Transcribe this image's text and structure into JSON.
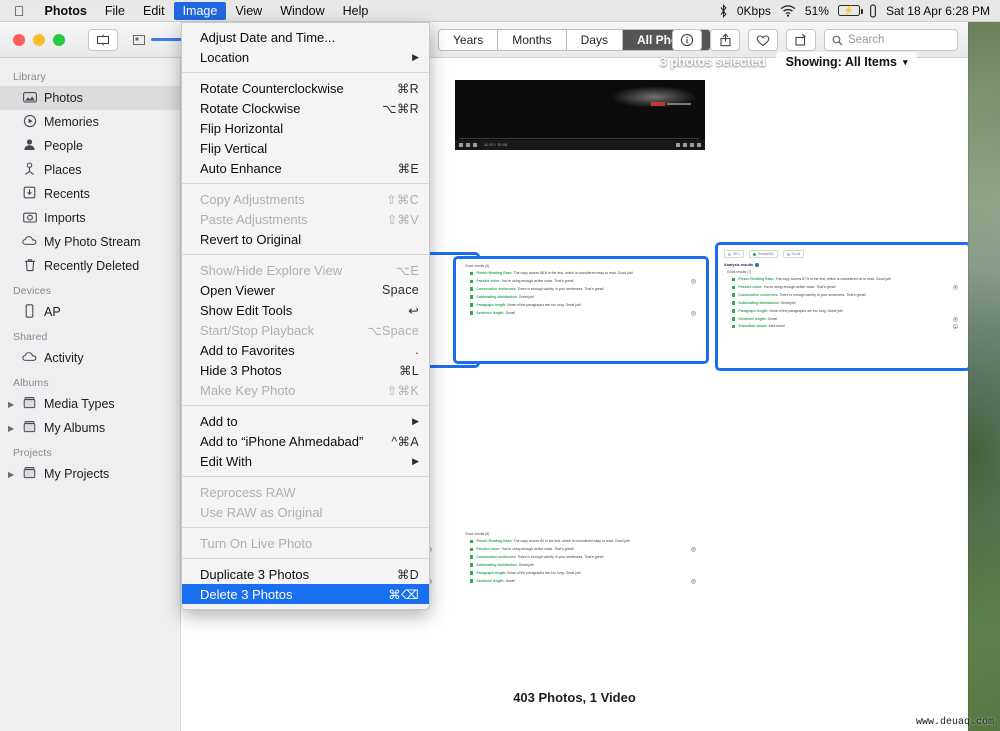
{
  "menubar": {
    "apple_icon": "apple-logo",
    "items": [
      {
        "label": "Photos",
        "bold": true,
        "active": false
      },
      {
        "label": "File",
        "bold": false,
        "active": false
      },
      {
        "label": "Edit",
        "bold": false,
        "active": false
      },
      {
        "label": "Image",
        "bold": false,
        "active": true
      },
      {
        "label": "View",
        "bold": false,
        "active": false
      },
      {
        "label": "Window",
        "bold": false,
        "active": false
      },
      {
        "label": "Help",
        "bold": false,
        "active": false
      }
    ],
    "status": {
      "bluetooth_icon": "bluetooth-icon",
      "network_speed": "0Kbps",
      "wifi_icon": "wifi-icon",
      "battery_percent": "51%",
      "battery_icon": "battery-charging-icon",
      "usb_icon": "usb-device-icon",
      "datetime": "Sat 18 Apr  6:28 PM"
    }
  },
  "toolbar": {
    "sidebar_toggle_icon": "sidebar-toggle-icon",
    "zoom_icon": "thumbnail-size-icon",
    "zoom_value": "100",
    "segments": [
      {
        "label": "Years",
        "on": false
      },
      {
        "label": "Months",
        "on": false
      },
      {
        "label": "Days",
        "on": false
      },
      {
        "label": "All Photos",
        "on": true
      }
    ],
    "info_icon": "info-icon",
    "share_icon": "share-icon",
    "favorite_icon": "heart-icon",
    "rotate_icon": "rotate-icon",
    "search_icon": "search-icon",
    "search_placeholder": "Search",
    "search_value": ""
  },
  "sidebar": {
    "sections": [
      {
        "title": "Library",
        "items": [
          {
            "label": "Photos",
            "icon": "photos-icon",
            "selected": true,
            "tri": false
          },
          {
            "label": "Memories",
            "icon": "memories-icon",
            "selected": false,
            "tri": false
          },
          {
            "label": "People",
            "icon": "people-icon",
            "selected": false,
            "tri": false
          },
          {
            "label": "Places",
            "icon": "places-pin-icon",
            "selected": false,
            "tri": false
          },
          {
            "label": "Recents",
            "icon": "recents-icon",
            "selected": false,
            "tri": false
          },
          {
            "label": "Imports",
            "icon": "imports-camera-icon",
            "selected": false,
            "tri": false
          },
          {
            "label": "My Photo Stream",
            "icon": "cloud-icon",
            "selected": false,
            "tri": false
          },
          {
            "label": "Recently Deleted",
            "icon": "trash-icon",
            "selected": false,
            "tri": false
          }
        ]
      },
      {
        "title": "Devices",
        "items": [
          {
            "label": "AP",
            "icon": "iphone-icon",
            "selected": false,
            "tri": false
          }
        ]
      },
      {
        "title": "Shared",
        "items": [
          {
            "label": "Activity",
            "icon": "cloud-icon",
            "selected": false,
            "tri": false
          }
        ]
      },
      {
        "title": "Albums",
        "items": [
          {
            "label": "Media Types",
            "icon": "album-icon",
            "selected": false,
            "tri": true
          },
          {
            "label": "My Albums",
            "icon": "album-icon",
            "selected": false,
            "tri": true
          }
        ]
      },
      {
        "title": "Projects",
        "items": [
          {
            "label": "My Projects",
            "icon": "album-icon",
            "selected": false,
            "tri": true
          }
        ]
      }
    ]
  },
  "selection_banner": {
    "text": "3 photos selected",
    "showing_label": "Showing: All Items",
    "chevron_icon": "chevron-down-icon"
  },
  "image_menu": {
    "groups": [
      {
        "items": [
          {
            "label": "Adjust Date and Time...",
            "key": "",
            "disabled": false,
            "submenu": false,
            "highlighted": false
          },
          {
            "label": "Location",
            "key": "",
            "disabled": false,
            "submenu": true,
            "highlighted": false
          }
        ]
      },
      {
        "items": [
          {
            "label": "Rotate Counterclockwise",
            "key": "⌘R",
            "disabled": false,
            "submenu": false,
            "highlighted": false
          },
          {
            "label": "Rotate Clockwise",
            "key": "⌥⌘R",
            "disabled": false,
            "submenu": false,
            "highlighted": false
          },
          {
            "label": "Flip Horizontal",
            "key": "",
            "disabled": false,
            "submenu": false,
            "highlighted": false
          },
          {
            "label": "Flip Vertical",
            "key": "",
            "disabled": false,
            "submenu": false,
            "highlighted": false
          },
          {
            "label": "Auto Enhance",
            "key": "⌘E",
            "disabled": false,
            "submenu": false,
            "highlighted": false
          }
        ]
      },
      {
        "items": [
          {
            "label": "Copy Adjustments",
            "key": "⇧⌘C",
            "disabled": true,
            "submenu": false,
            "highlighted": false
          },
          {
            "label": "Paste Adjustments",
            "key": "⇧⌘V",
            "disabled": true,
            "submenu": false,
            "highlighted": false
          },
          {
            "label": "Revert to Original",
            "key": "",
            "disabled": false,
            "submenu": false,
            "highlighted": false
          }
        ]
      },
      {
        "items": [
          {
            "label": "Show/Hide Explore View",
            "key": "⌥E",
            "disabled": true,
            "submenu": false,
            "highlighted": false
          },
          {
            "label": "Open Viewer",
            "key": "Space",
            "disabled": false,
            "submenu": false,
            "highlighted": false
          },
          {
            "label": "Show Edit Tools",
            "key": "↩",
            "disabled": false,
            "submenu": false,
            "highlighted": false
          },
          {
            "label": "Start/Stop Playback",
            "key": "⌥Space",
            "disabled": true,
            "submenu": false,
            "highlighted": false
          },
          {
            "label": "Add to Favorites",
            "key": ".",
            "disabled": false,
            "submenu": false,
            "highlighted": false
          },
          {
            "label": "Hide 3 Photos",
            "key": "⌘L",
            "disabled": false,
            "submenu": false,
            "highlighted": false
          },
          {
            "label": "Make Key Photo",
            "key": "⇧⌘K",
            "disabled": true,
            "submenu": false,
            "highlighted": false
          }
        ]
      },
      {
        "items": [
          {
            "label": "Add to",
            "key": "",
            "disabled": false,
            "submenu": true,
            "highlighted": false
          },
          {
            "label": "Add to “iPhone Ahmedabad”",
            "key": "^⌘A",
            "disabled": false,
            "submenu": false,
            "highlighted": false
          },
          {
            "label": "Edit With",
            "key": "",
            "disabled": false,
            "submenu": true,
            "highlighted": false
          }
        ]
      },
      {
        "items": [
          {
            "label": "Reprocess RAW",
            "key": "",
            "disabled": true,
            "submenu": false,
            "highlighted": false
          },
          {
            "label": "Use RAW as Original",
            "key": "",
            "disabled": true,
            "submenu": false,
            "highlighted": false
          }
        ]
      },
      {
        "items": [
          {
            "label": "Turn On Live Photo",
            "key": "",
            "disabled": true,
            "submenu": false,
            "highlighted": false
          }
        ]
      },
      {
        "items": [
          {
            "label": "Duplicate 3 Photos",
            "key": "⌘D",
            "disabled": false,
            "submenu": false,
            "highlighted": false
          },
          {
            "label": "Delete 3 Photos",
            "key": "⌘⌫",
            "disabled": false,
            "submenu": false,
            "highlighted": true
          }
        ]
      }
    ]
  },
  "grid": {
    "status_text": "403 Photos, 1 Video",
    "video_thumb": {
      "name": "video-thumbnail",
      "timecode": "11:20 / 30:05"
    },
    "seo_thumbs": [
      {
        "name": "seo-thumbnail-1",
        "selected": true,
        "tabs": [],
        "analysis_title": "",
        "group": "Good results (6)",
        "lines": [
          {
            "key": "Flesch Reading Ease:",
            "text": " The copy scores 86.8 in the test, which is considered easy to read. Good job!",
            "eye": false
          },
          {
            "key": "Passive voice:",
            "text": " You're using enough active voice. That's great!",
            "eye": true
          },
          {
            "key": "Consecutive sentences:",
            "text": " There is enough variety in your sentences. That's great!",
            "eye": false
          },
          {
            "key": "Subheading distribution:",
            "text": " Great job!",
            "eye": false
          },
          {
            "key": "Paragraph length:",
            "text": " None of the paragraphs are too long. Great job!",
            "eye": false
          },
          {
            "key": "Sentence length:",
            "text": " Great!",
            "eye": true
          }
        ]
      },
      {
        "name": "seo-thumbnail-2",
        "selected": true,
        "tabs": [
          {
            "label": "SEO",
            "green": false
          },
          {
            "label": "Readability",
            "green": true
          },
          {
            "label": "Social",
            "green": false
          }
        ],
        "analysis_title": "Analysis results",
        "group": "Good results (7)",
        "lines": [
          {
            "key": "Flesch Reading Ease:",
            "text": " The copy scores 67.5 in the test, which is considered ok to read. Good job!",
            "eye": false
          },
          {
            "key": "Passive voice:",
            "text": " You're using enough active voice. That's great!",
            "eye": true
          },
          {
            "key": "Consecutive sentences:",
            "text": " There is enough variety in your sentences. That's great!",
            "eye": false
          },
          {
            "key": "Subheading distribution:",
            "text": " Great job!",
            "eye": false
          },
          {
            "key": "Paragraph length:",
            "text": " None of the paragraphs are too long. Great job!",
            "eye": false
          },
          {
            "key": "Sentence length:",
            "text": " Great!",
            "eye": true
          },
          {
            "key": "Transition words:",
            "text": " Well done!",
            "eye": true
          }
        ]
      },
      {
        "name": "seo-thumbnail-3",
        "selected": false,
        "tabs": [],
        "analysis_title": "",
        "group": "Good results (6)",
        "lines": [
          {
            "key": "Flesch Reading Ease:",
            "text": " The copy scores 80 in the test, which is considered easy to read. Good job!",
            "eye": false
          },
          {
            "key": "Passive voice:",
            "text": " You're using enough active voice. That's great!",
            "eye": true
          },
          {
            "key": "Consecutive sentences:",
            "text": " There is enough variety in your sentences. That's great!",
            "eye": false
          },
          {
            "key": "Subheading distribution:",
            "text": " Great job!",
            "eye": false
          },
          {
            "key": "Paragraph length:",
            "text": " None of the paragraphs are too long. Great job!",
            "eye": false
          },
          {
            "key": "Sentence length:",
            "text": " Great!",
            "eye": true
          }
        ]
      }
    ]
  },
  "watermark": {
    "text": "www.deuaq.com"
  },
  "colors": {
    "accent": "#1a6ff0",
    "selection_outline": "#1b6df0",
    "sidebar_bg": "#efeff1",
    "menu_bg": "#f4f4f4"
  }
}
